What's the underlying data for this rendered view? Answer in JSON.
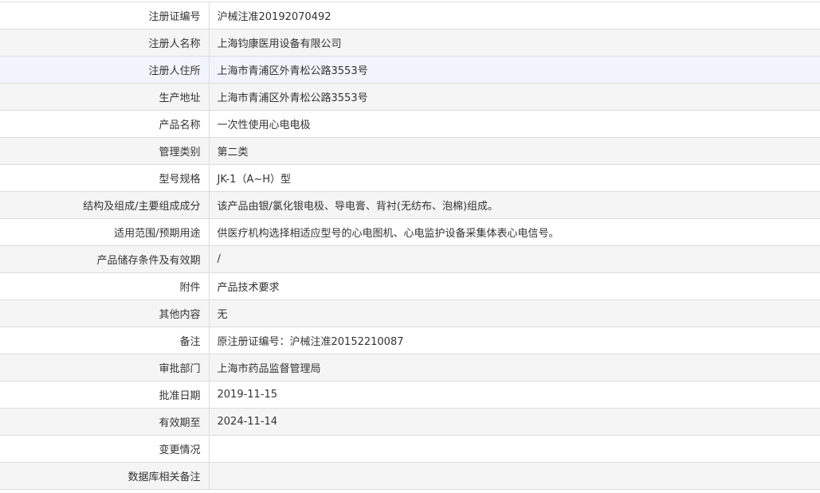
{
  "record": {
    "rows": [
      {
        "label": "注册证编号",
        "value": "沪械注准20192070492"
      },
      {
        "label": "注册人名称",
        "value": "上海钧康医用设备有限公司"
      },
      {
        "label": "注册人住所",
        "value": "上海市青浦区外青松公路3553号"
      },
      {
        "label": "生产地址",
        "value": "上海市青浦区外青松公路3553号"
      },
      {
        "label": "产品名称",
        "value": "一次性使用心电电极"
      },
      {
        "label": "管理类别",
        "value": "第二类"
      },
      {
        "label": "型号规格",
        "value": "JK-1（A~H）型"
      },
      {
        "label": "结构及组成/主要组成成分",
        "value": "该产品由银/氯化银电极、导电膏、背衬(无纺布、泡棉)组成。"
      },
      {
        "label": "适用范围/预期用途",
        "value": "供医疗机构选择相适应型号的心电图机、心电监护设备采集体表心电信号。"
      },
      {
        "label": "产品储存条件及有效期",
        "value": "/"
      },
      {
        "label": "附件",
        "value": "产品技术要求"
      },
      {
        "label": "其他内容",
        "value": "无"
      },
      {
        "label": "备注",
        "value": "原注册证编号：沪械注准20152210087"
      },
      {
        "label": "审批部门",
        "value": "上海市药品监督管理局"
      },
      {
        "label": "批准日期",
        "value": "2019-11-15"
      },
      {
        "label": "有效期至",
        "value": "2024-11-14"
      },
      {
        "label": "变更情况",
        "value": ""
      },
      {
        "label": "数据库相关备注",
        "value": ""
      }
    ]
  }
}
